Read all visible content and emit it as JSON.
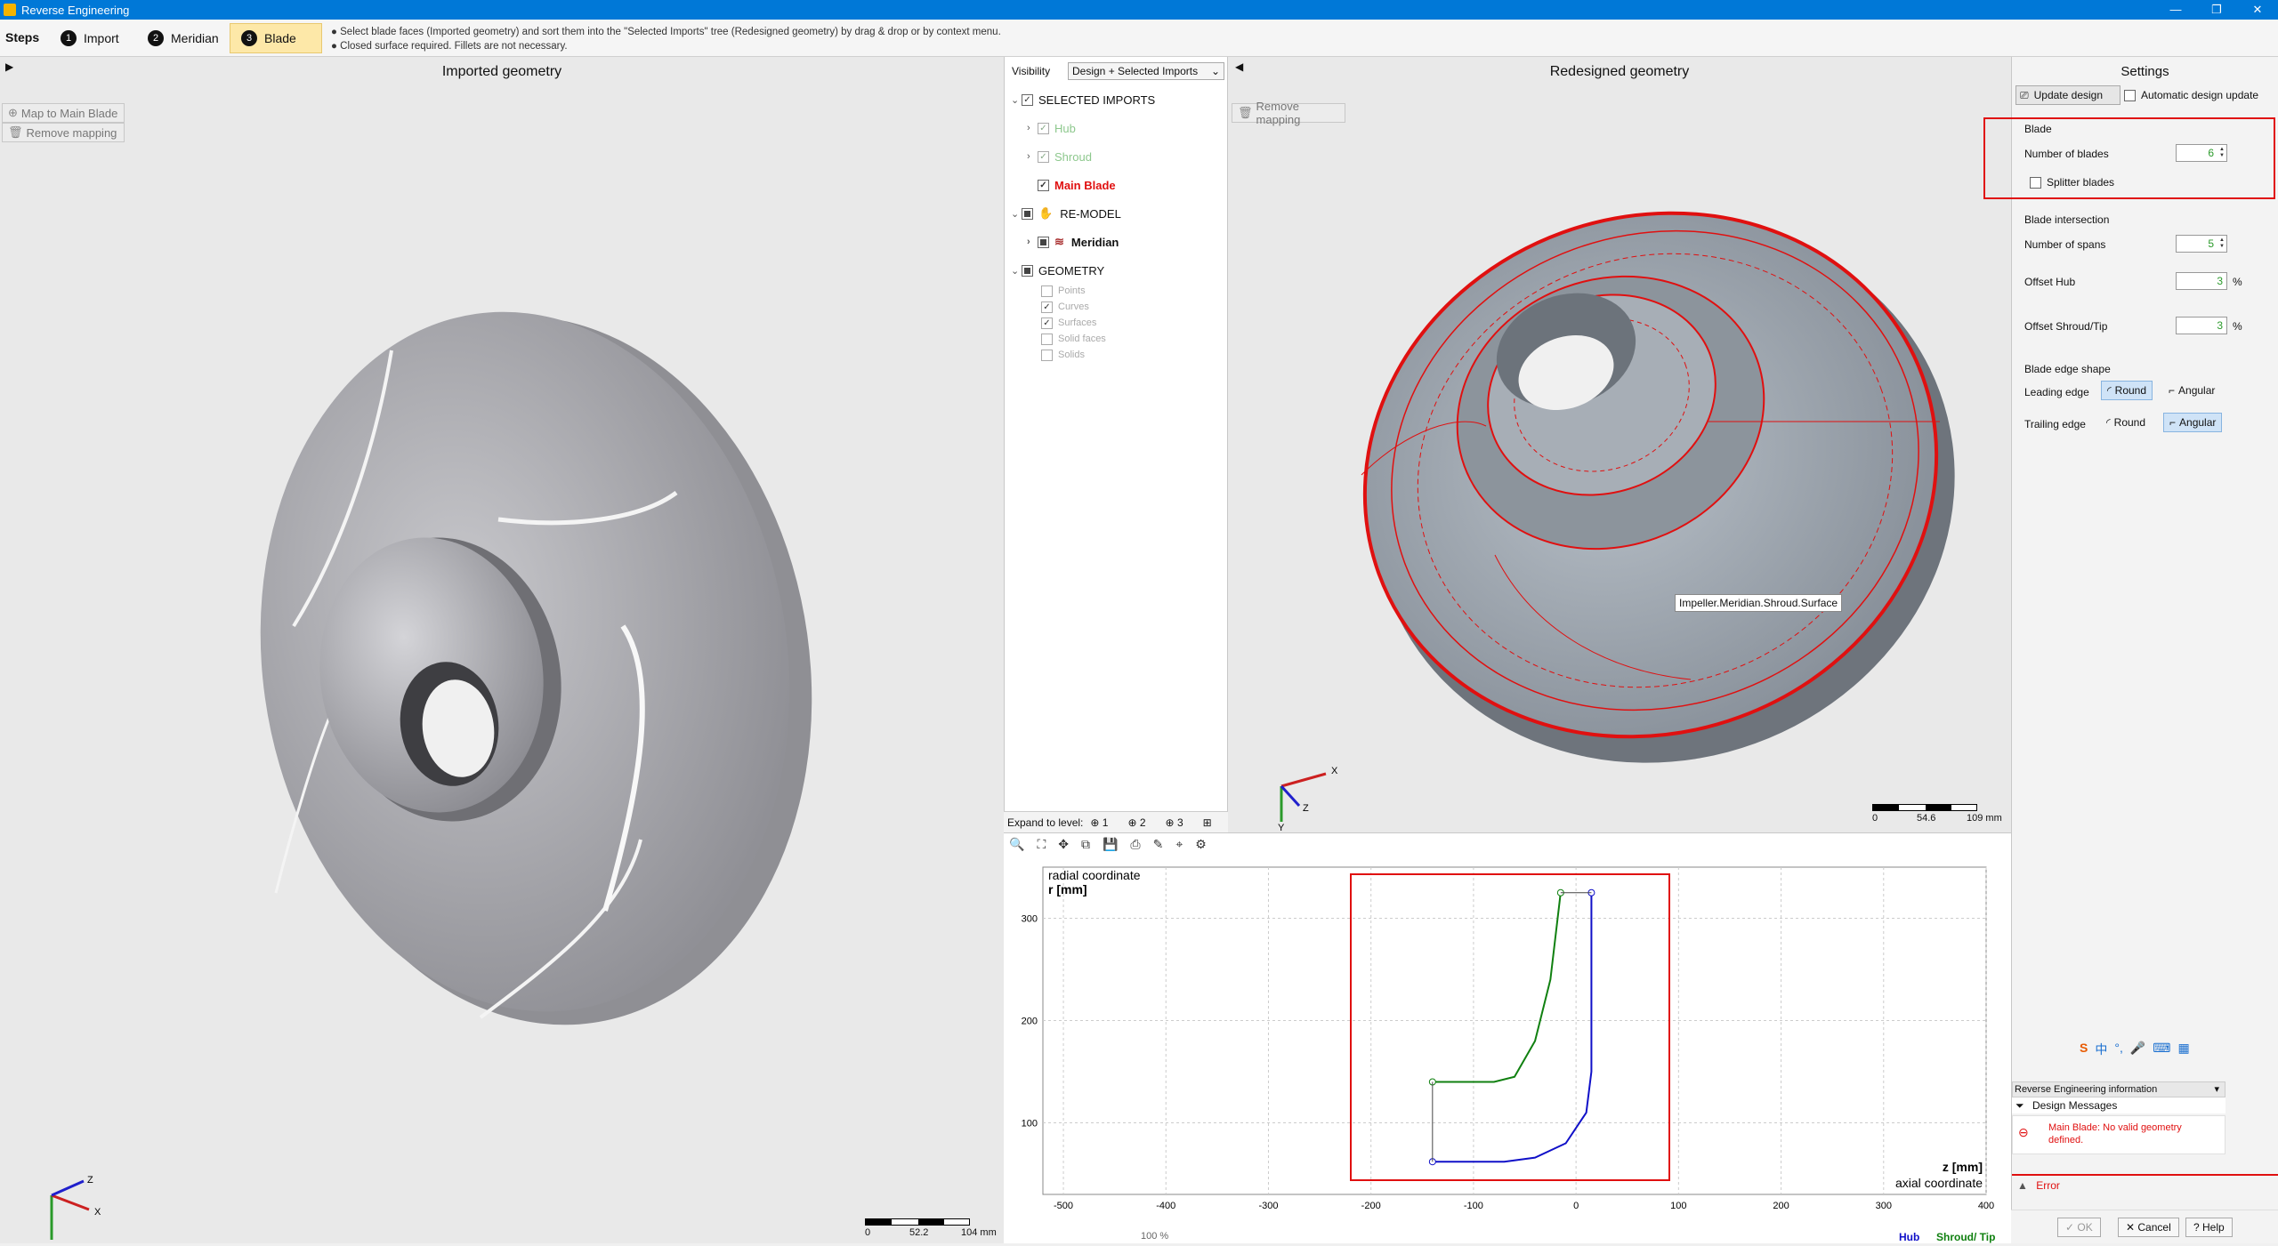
{
  "window": {
    "title": "Reverse Engineering",
    "controls": [
      "—",
      "❐",
      "✕"
    ]
  },
  "steps": {
    "label": "Steps",
    "items": [
      {
        "num": "1",
        "label": "Import"
      },
      {
        "num": "2",
        "label": "Meridian"
      },
      {
        "num": "3",
        "label": "Blade"
      }
    ],
    "hint_line1": "● Select blade faces (Imported geometry) and sort them into the \"Selected Imports\" tree (Redesigned geometry) by drag & drop or by context menu.",
    "hint_line2": "● Closed surface required. Fillets are not necessary."
  },
  "imported": {
    "title": "Imported geometry",
    "map_button": "Map to Main Blade",
    "remove_button": "Remove mapping",
    "scale_labels": [
      "0",
      "52.2",
      "104 mm"
    ],
    "axes": {
      "z": "Z",
      "x": "X"
    }
  },
  "tree": {
    "visibility_label": "Visibility",
    "visibility_value": "Design + Selected Imports",
    "selected_imports": "SELECTED IMPORTS",
    "hub": "Hub",
    "shroud": "Shroud",
    "main_blade": "Main Blade",
    "remodel": "RE-MODEL",
    "meridian": "Meridian",
    "geometry": "GEOMETRY",
    "geo_items": [
      "Points",
      "Curves",
      "Surfaces",
      "Solid faces",
      "Solids"
    ],
    "expand_label": "Expand to level:",
    "levels": [
      "1",
      "2",
      "3"
    ]
  },
  "redesigned": {
    "title": "Redesigned geometry",
    "remove_button": "Remove mapping",
    "tooltip": "Impeller.Meridian.Shroud.Surface",
    "scale_labels": [
      "0",
      "54.6",
      "109 mm"
    ],
    "axes": {
      "x": "X",
      "z": "Z",
      "y": "Y"
    }
  },
  "settings": {
    "title": "Settings",
    "update_design": "Update design",
    "auto_update": "Automatic design update",
    "blade_section": "Blade",
    "number_of_blades_label": "Number of blades",
    "number_of_blades": "6",
    "splitter_blades": "Splitter blades",
    "intersection_section": "Blade intersection",
    "spans_label": "Number of spans",
    "spans": "5",
    "offset_hub_label": "Offset Hub",
    "offset_hub": "3",
    "offset_shroud_label": "Offset Shroud/Tip",
    "offset_shroud": "3",
    "pct": "%",
    "edge_section": "Blade edge shape",
    "leading_label": "Leading edge",
    "trailing_label": "Trailing edge",
    "round": "Round",
    "angular": "Angular",
    "leading_selected": "Round",
    "trailing_selected": "Angular"
  },
  "info": {
    "header": "Reverse Engineering information",
    "design_messages": "Design Messages",
    "error_msg_1": "Main Blade: No valid geometry",
    "error_msg_2": "defined.",
    "error_label": "Error"
  },
  "buttons": {
    "ok": "OK",
    "cancel": "Cancel",
    "help": "Help"
  },
  "chart": {
    "zoom": "100 %"
  },
  "chart_data": {
    "type": "line",
    "xlabel": "z [mm]",
    "xlabel2": "axial coordinate",
    "ylabel": "r [mm]",
    "ylabel2": "radial coordinate",
    "xlim": [
      -520,
      400
    ],
    "ylim": [
      30,
      350
    ],
    "xticks": [
      -500,
      -400,
      -300,
      -200,
      -100,
      0,
      100,
      200,
      300,
      400
    ],
    "yticks": [
      100,
      200,
      300
    ],
    "grid": true,
    "series": [
      {
        "name": "Hub",
        "color": "#1010c8",
        "points": [
          [
            -140,
            62
          ],
          [
            -70,
            62
          ],
          [
            -40,
            66
          ],
          [
            -10,
            80
          ],
          [
            10,
            110
          ],
          [
            15,
            150
          ],
          [
            15,
            325
          ]
        ]
      },
      {
        "name": "Shroud/ Tip",
        "color": "#108010",
        "points": [
          [
            -140,
            140
          ],
          [
            -80,
            140
          ],
          [
            -60,
            145
          ],
          [
            -40,
            180
          ],
          [
            -25,
            240
          ],
          [
            -15,
            325
          ]
        ]
      }
    ],
    "legend": [
      "Hub",
      "Shroud/ Tip"
    ]
  }
}
